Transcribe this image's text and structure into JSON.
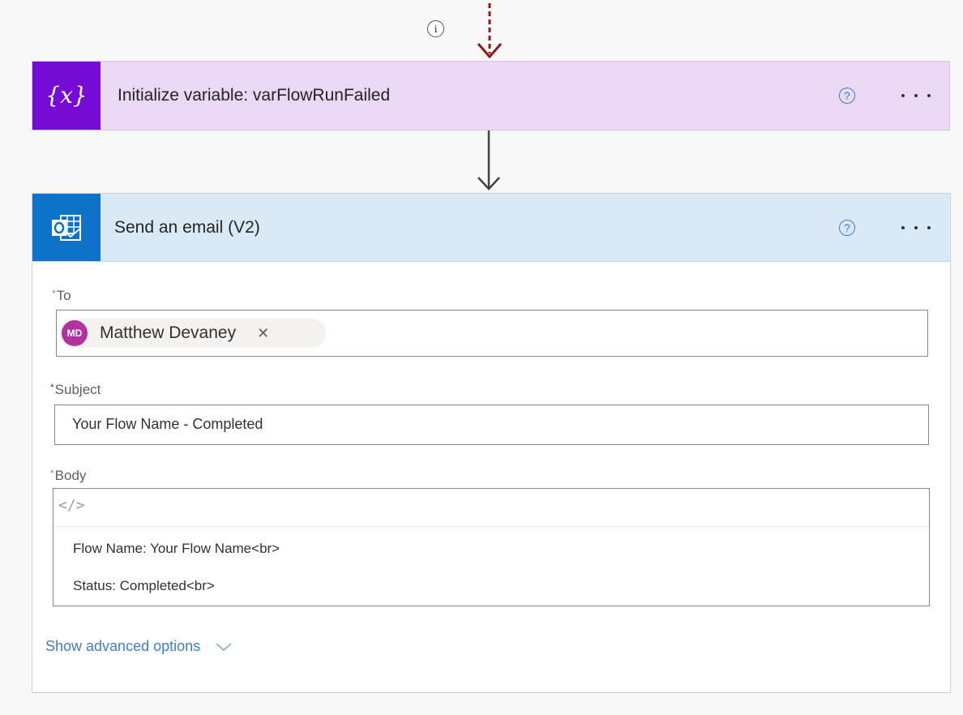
{
  "colors": {
    "variable_accent": "#770bd6",
    "variable_header": "#ead8f5",
    "email_accent": "#0f72c9",
    "email_header": "#d9e9f6",
    "dashed_arrow": "#8b1a1a",
    "link": "#3f7fc7"
  },
  "top_connector": {
    "info_icon": "info-icon"
  },
  "initialize_variable": {
    "icon": "variable-x-icon",
    "icon_text": "{x}",
    "title": "Initialize variable: varFlowRunFailed",
    "help_icon": "?",
    "more_icon": "ellipsis-icon"
  },
  "send_email": {
    "icon": "outlook-icon",
    "title": "Send an email (V2)",
    "help_icon": "?",
    "more_icon": "ellipsis-icon",
    "to": {
      "required_mark": "*",
      "label": "To",
      "recipient_initials": "MD",
      "recipient_name": "Matthew Devaney",
      "remove_glyph": "✕"
    },
    "subject": {
      "required_mark": "*",
      "label": "Subject",
      "value": "Your Flow Name -  Completed"
    },
    "body": {
      "required_mark": "*",
      "label": "Body",
      "code_toggle": "</>",
      "lines": [
        "Flow Name: Your Flow Name<br>",
        "Status: Completed<br>"
      ]
    },
    "advanced_options": "Show advanced options"
  }
}
